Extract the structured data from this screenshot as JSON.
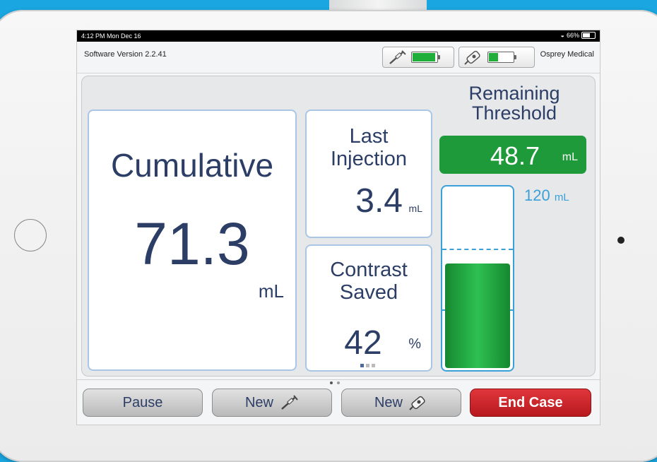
{
  "statusbar": {
    "time": "4:12 PM  Mon Dec 16",
    "battery": "66%",
    "wifi_icon": "wifi-icon",
    "battery_icon": "battery-icon"
  },
  "header": {
    "version": "Software Version 2.2.41",
    "brand": "Osprey Medical",
    "devices": [
      {
        "icon": "syringe-icon",
        "battery_level": 1.0
      },
      {
        "icon": "injector-icon",
        "battery_level": 0.4
      }
    ],
    "battery_color": "#1fae3a"
  },
  "cumulative": {
    "label": "Cumulative",
    "value": "71.3",
    "unit": "mL"
  },
  "last_injection": {
    "label_line1": "Last",
    "label_line2": "Injection",
    "value": "3.4",
    "unit": "mL"
  },
  "contrast_saved": {
    "label_line1": "Contrast",
    "label_line2": "Saved",
    "value": "42",
    "unit": "%"
  },
  "threshold": {
    "title_line1": "Remaining",
    "title_line2": "Threshold",
    "remaining_value": "48.7",
    "remaining_unit": "mL",
    "limit_value": "120",
    "limit_unit": "mL",
    "used_fraction": 0.59,
    "accent_color": "#3b9fd8",
    "fill_color": "#1f9a3a"
  },
  "toolbar": {
    "pause_label": "Pause",
    "new_syringe_label": "New",
    "new_injector_label": "New",
    "end_case_label": "End Case",
    "end_case_color": "#c9252b"
  }
}
